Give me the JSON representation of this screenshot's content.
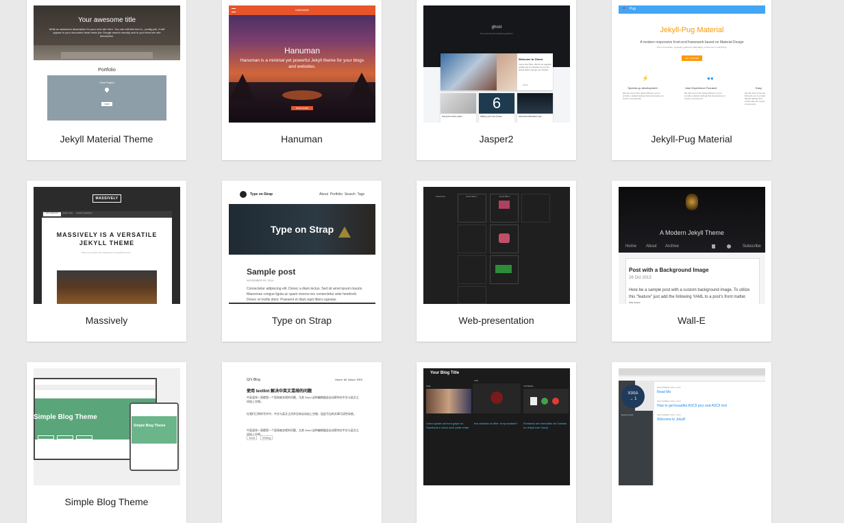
{
  "themes": [
    {
      "title": "Jekyll Material Theme",
      "thumb": {
        "hero_title": "Your awesome title",
        "hero_text": "Write an awesome description for your new site here. You can edit this line in _config.yml. It will appear in your document head meta (for Google search results) and in your feed.xml site description.",
        "section": "Portfolio",
        "item": "First Project",
        "button": "VIEW"
      }
    },
    {
      "title": "Hanuman",
      "thumb": {
        "brand": "HANUMAN",
        "heading": "Hanuman",
        "tagline": "Hanuman is a minimal yet powerful Jekyll theme for your blogs and websites.",
        "button": "READ MORE"
      }
    },
    {
      "title": "Jasper2",
      "thumb": {
        "brand": "ghost",
        "tagline": "The professional publishing platform",
        "post1_title": "Welcome to Ghost",
        "post1_text": "You're live! Nice. We've put together a little post to introduce you to the Ghost editor and get you started.",
        "author": "Ghost",
        "post2_title": "Using the Ghost editor",
        "post3_title": "Making your site private",
        "post4_title": "Advanced Markdown tips"
      }
    },
    {
      "title": "Jekyll-Pug Material",
      "thumb": {
        "brand": "Pug",
        "heading": "Jekyll-Pug Material",
        "tagline": "A modern responsive front-end framework based on Material Design",
        "subtag": "This is a template, originally created by Materialize, ported over to Jekyll-Pug.",
        "button": "GET STARTED",
        "feature1": "Speeds up development",
        "feature2": "User Experience Focused",
        "feature3": "Easy",
        "feature_text": "We did most of the heavy lifting for you to provide a default stylings that incorporate our custom components."
      }
    },
    {
      "title": "Massively",
      "thumb": {
        "logo": "MASSIVELY",
        "nav": [
          "THIS IS MASSIVELY",
          "GENERIC PAGE",
          "ELEMENTS REFERENCE"
        ],
        "heading_line1": "MASSIVELY IS A VERSATILE",
        "heading_line2": "JEKYLL THEME",
        "text": "With a very clean vibe, Massively is a beautiful theme..."
      }
    },
    {
      "title": "Type on Strap",
      "thumb": {
        "brand": "Type on Strap",
        "nav": "About  Portfolio  Search  Tags",
        "hero": "Type on Strap",
        "post_title": "Sample post",
        "post_date": "NOVEMBER 09, 2014",
        "post_text": "Consectetur adipiscing elit. Donec a diam lectus. Sed sit amet ipsum mauris. Maecenas congue ligula ac quam viverra nec consectetur ante hendrerit. Donec et mollis dolor. Praesent et diam eget libero egestas"
      }
    },
    {
      "title": "Web-presentation",
      "thumb": {
        "col1": "WALKING",
        "col2": "CHAPTER 1",
        "col3": "CHAPTER 2"
      }
    },
    {
      "title": "Wall-E",
      "thumb": {
        "hero": "A Modern Jekyll Theme",
        "nav": [
          "Home",
          "About",
          "Archive",
          "Subscribe"
        ],
        "post_title": "Post with a Background Image",
        "post_date": "26 Oct 2013",
        "post_text": "Here be a sample post with a custom background image. To utilize this \"feature\" just add the following YAML to a post's front matter. image:"
      }
    },
    {
      "title": "Simple Blog Theme",
      "thumb": {
        "heading": "Simple Blog Theme",
        "sub": "Simple Blog Theme"
      }
    },
    {
      "title": "",
      "thumb": {
        "brand": "Qi's Blog",
        "nav": "Home  All  About  RSS",
        "post_title": "使用 textlint 解决中英文混排的问题",
        "para1": "中英混排一直都是一个容易被忽视的问题，尤其 Word 这种编辑器会自动帮你在中文与英文之间加上空格。",
        "para2": "在我们日常的写作中，中文与英文之间并没有自动加上空格，因此写出的文章可读性较差。",
        "tag1": "Tools",
        "tag2": "Writing"
      }
    },
    {
      "title": "",
      "thumb": {
        "brand": "Your Blog Title",
        "col1": "LIFE",
        "col2": "CSS",
        "col3": "TUTORIAL",
        "post1": "Como quase cai num golpe no Facebook e como você pode evitar",
        "post2": "box-shadow ou filter: drop-shadow?",
        "post3": "Enviando um formulário de Contato no Jekyll com Vue.js"
      }
    },
    {
      "title": "",
      "thumb": {
        "logo_line1": "XIXIA",
        "logo_line2": "→ 1",
        "recent": "Recent posts",
        "date1": "SEPTEMBER 19TH, 2017",
        "post1": "Read Me",
        "date2": "SEPTEMBER 19TH, 2017",
        "post2": "How to get beautiful ASCII pics and ASCII text",
        "date3": "SEPTEMBER 19TH, 2017",
        "post3": "Welcome to Jekyll!"
      }
    }
  ]
}
